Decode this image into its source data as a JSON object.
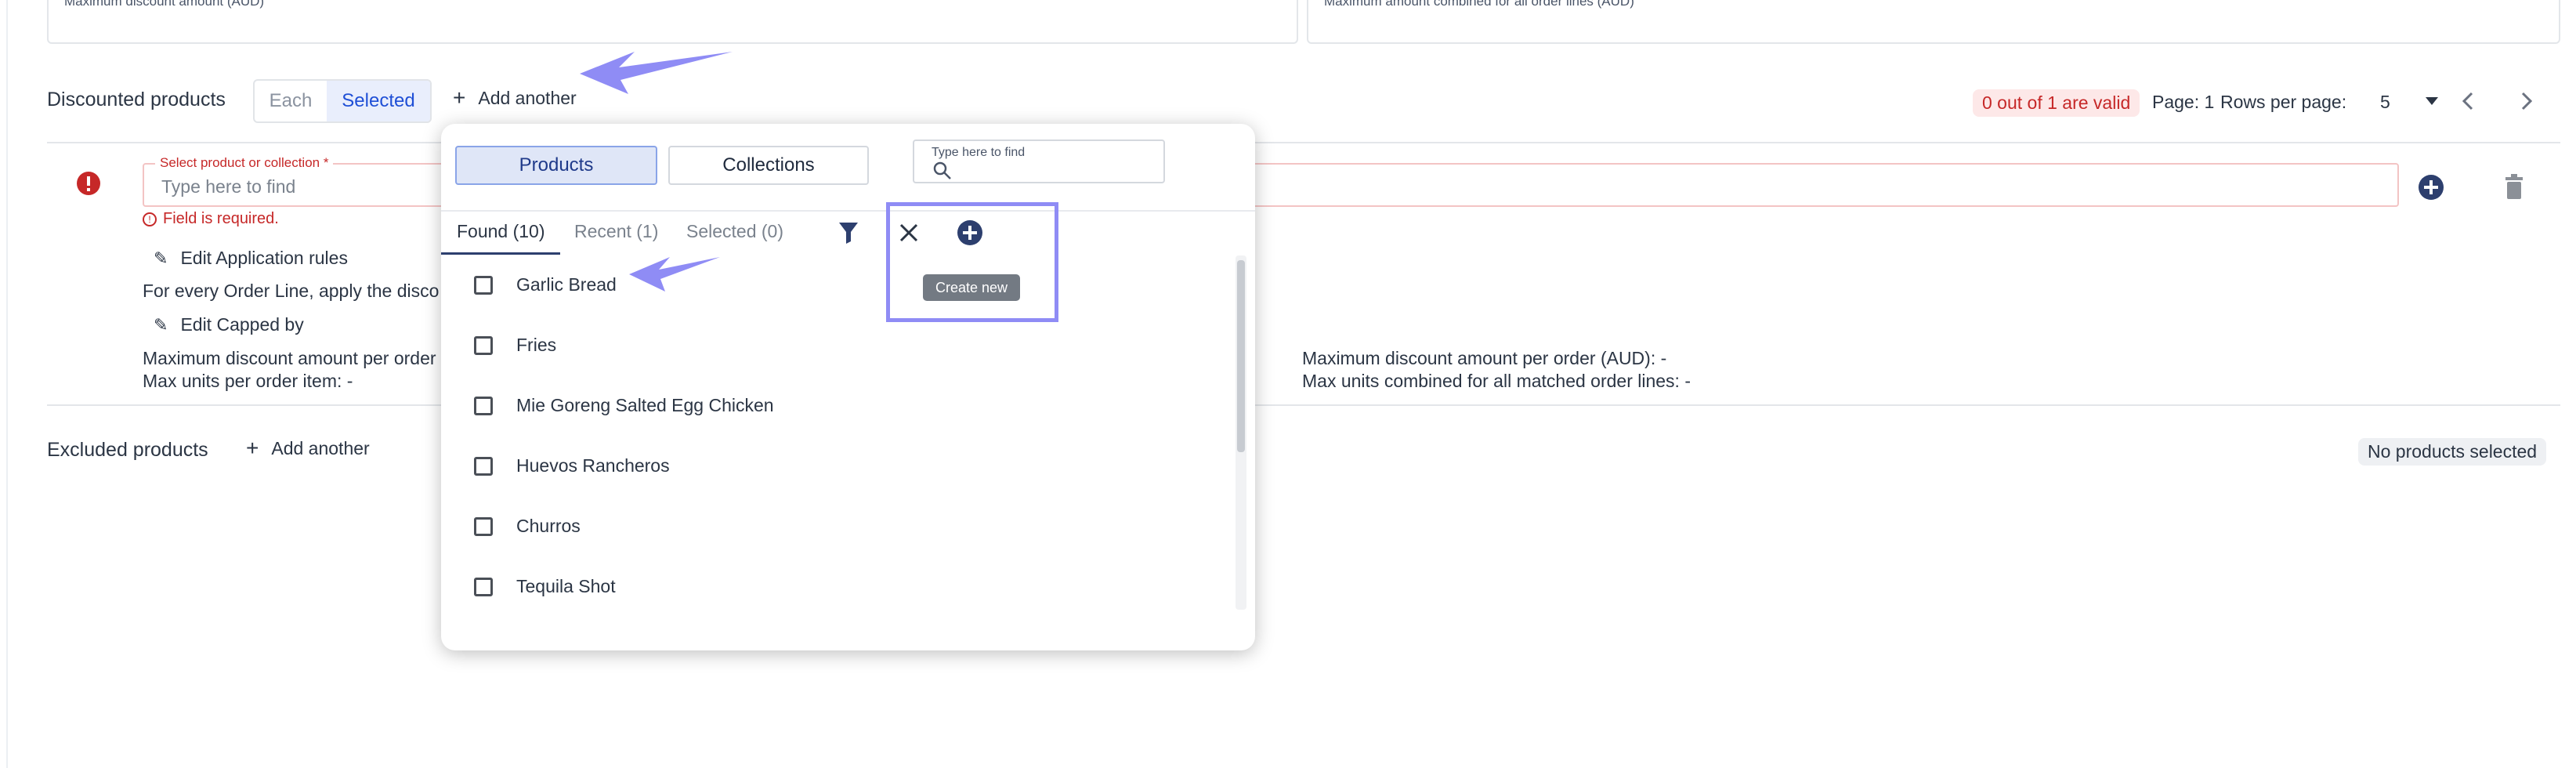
{
  "top_fields": {
    "max_discount_label": "Maximum discount amount (AUD)",
    "max_combined_label": "Maximum amount combined for all order lines (AUD)"
  },
  "discounted": {
    "title": "Discounted products",
    "seg_each": "Each",
    "seg_selected": "Selected",
    "add_another": "Add another",
    "valid_badge": "0 out of 1 are valid",
    "page_label": "Page: 1",
    "rows_label": "Rows per page:",
    "rows_value": "5",
    "field_label": "Select product or collection *",
    "field_placeholder": "Type here to find",
    "field_error": "Field is required.",
    "edit_rules": "Edit Application rules",
    "rules_text": "For every Order Line, apply the disco",
    "edit_capped": "Edit Capped by",
    "max_per_order": "Maximum discount amount per order",
    "max_units_item": "Max units per order item: -",
    "max_per_order_right": "Maximum discount amount per order (AUD): -",
    "max_units_combined": "Max units combined for all matched order lines: -"
  },
  "excluded": {
    "title": "Excluded products",
    "add_another": "Add another",
    "badge": "No products selected"
  },
  "popup": {
    "btn_products": "Products",
    "btn_collections": "Collections",
    "search_label": "Type here to find",
    "tabs": {
      "found": "Found (10)",
      "recent": "Recent (1)",
      "selected": "Selected (0)"
    },
    "tooltip": "Create new",
    "items": [
      "Garlic Bread",
      "Fries",
      "Mie Goreng Salted Egg Chicken",
      "Huevos Rancheros",
      "Churros",
      "Tequila Shot"
    ]
  },
  "colors": {
    "accent": "#1f4fd6",
    "annotation": "#8f8cf5",
    "error": "#c62828"
  }
}
